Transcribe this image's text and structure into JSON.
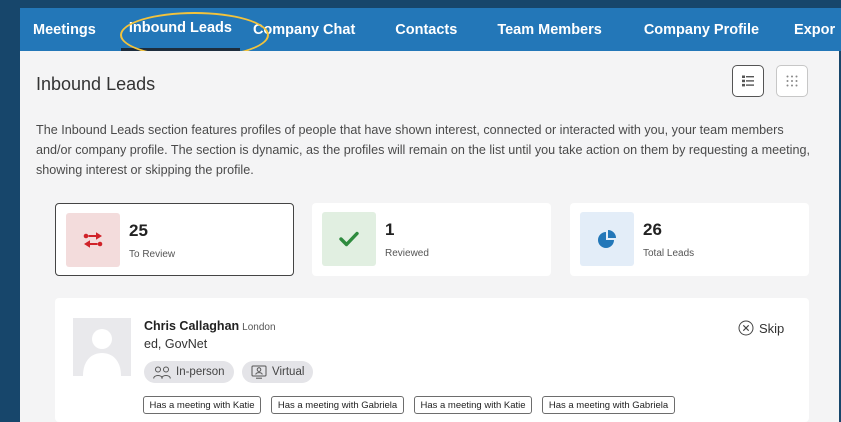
{
  "nav": {
    "tabs": [
      {
        "label": "Meetings"
      },
      {
        "label": "Inbound Leads"
      },
      {
        "label": "Company Chat"
      },
      {
        "label": "Contacts"
      },
      {
        "label": "Team Members"
      },
      {
        "label": "Company Profile"
      },
      {
        "label": "Expor"
      }
    ]
  },
  "page": {
    "title": "Inbound Leads",
    "description": "The Inbound Leads section features profiles of people that have shown interest, connected or interacted with you, your team members and/or company profile. The section is dynamic, as the profiles will remain on the list until you take action on them by requesting a meeting, showing interest or skipping the profile."
  },
  "view_toggle": {
    "options": [
      "list-view-icon",
      "grid-view-icon"
    ],
    "selected": "list-view-icon"
  },
  "stats": [
    {
      "value": "25",
      "label": "To Review",
      "icon": "swap-arrows-icon",
      "icon_color": "#d0232a",
      "icon_bg": "#f3dcdc"
    },
    {
      "value": "1",
      "label": "Reviewed",
      "icon": "checkmark-icon",
      "icon_color": "#2e8b3e",
      "icon_bg": "#e1efe1"
    },
    {
      "value": "26",
      "label": "Total Leads",
      "icon": "pie-chart-icon",
      "icon_color": "#2377b8",
      "icon_bg": "#e3edf8"
    }
  ],
  "lead": {
    "name": "Chris Callaghan",
    "location": "London",
    "company": "ed, GovNet",
    "skip_label": "Skip",
    "meeting_types": [
      {
        "label": "In-person",
        "icon": "people-icon"
      },
      {
        "label": "Virtual",
        "icon": "monitor-person-icon"
      }
    ],
    "tags": [
      "Has a meeting with Katie",
      "Has a meeting with Gabriela",
      "Has a meeting with Katie",
      "Has a meeting with Gabriela"
    ]
  },
  "colors": {
    "nav_bg": "#2377b8",
    "page_bg": "#17466b",
    "highlight": "#f3c33c"
  }
}
